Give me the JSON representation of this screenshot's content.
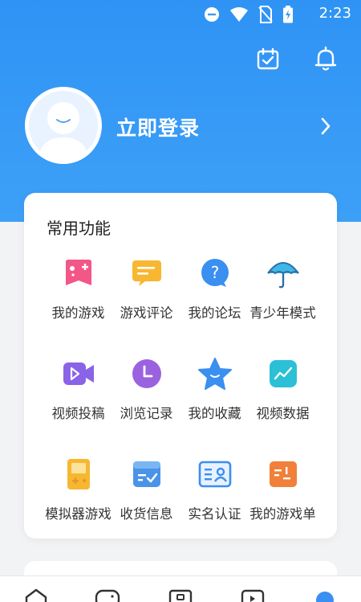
{
  "status": {
    "time": "2:23"
  },
  "profile": {
    "login_text": "立即登录"
  },
  "common": {
    "title": "常用功能",
    "items": [
      {
        "label": "我的游戏",
        "icon": "gamepad-icon"
      },
      {
        "label": "游戏评论",
        "icon": "comment-icon"
      },
      {
        "label": "我的论坛",
        "icon": "forum-question-icon"
      },
      {
        "label": "青少年模式",
        "icon": "umbrella-icon"
      },
      {
        "label": "视频投稿",
        "icon": "video-camera-icon"
      },
      {
        "label": "浏览记录",
        "icon": "clock-icon"
      },
      {
        "label": "我的收藏",
        "icon": "star-icon"
      },
      {
        "label": "视频数据",
        "icon": "trend-chart-icon"
      },
      {
        "label": "模拟器游戏",
        "icon": "handheld-console-icon"
      },
      {
        "label": "收货信息",
        "icon": "delivery-box-icon"
      },
      {
        "label": "实名认证",
        "icon": "id-card-icon"
      },
      {
        "label": "我的游戏单",
        "icon": "game-list-icon"
      }
    ]
  },
  "colors": {
    "hero_blue": "#2f93f5",
    "accent": "#3a8ff0"
  }
}
